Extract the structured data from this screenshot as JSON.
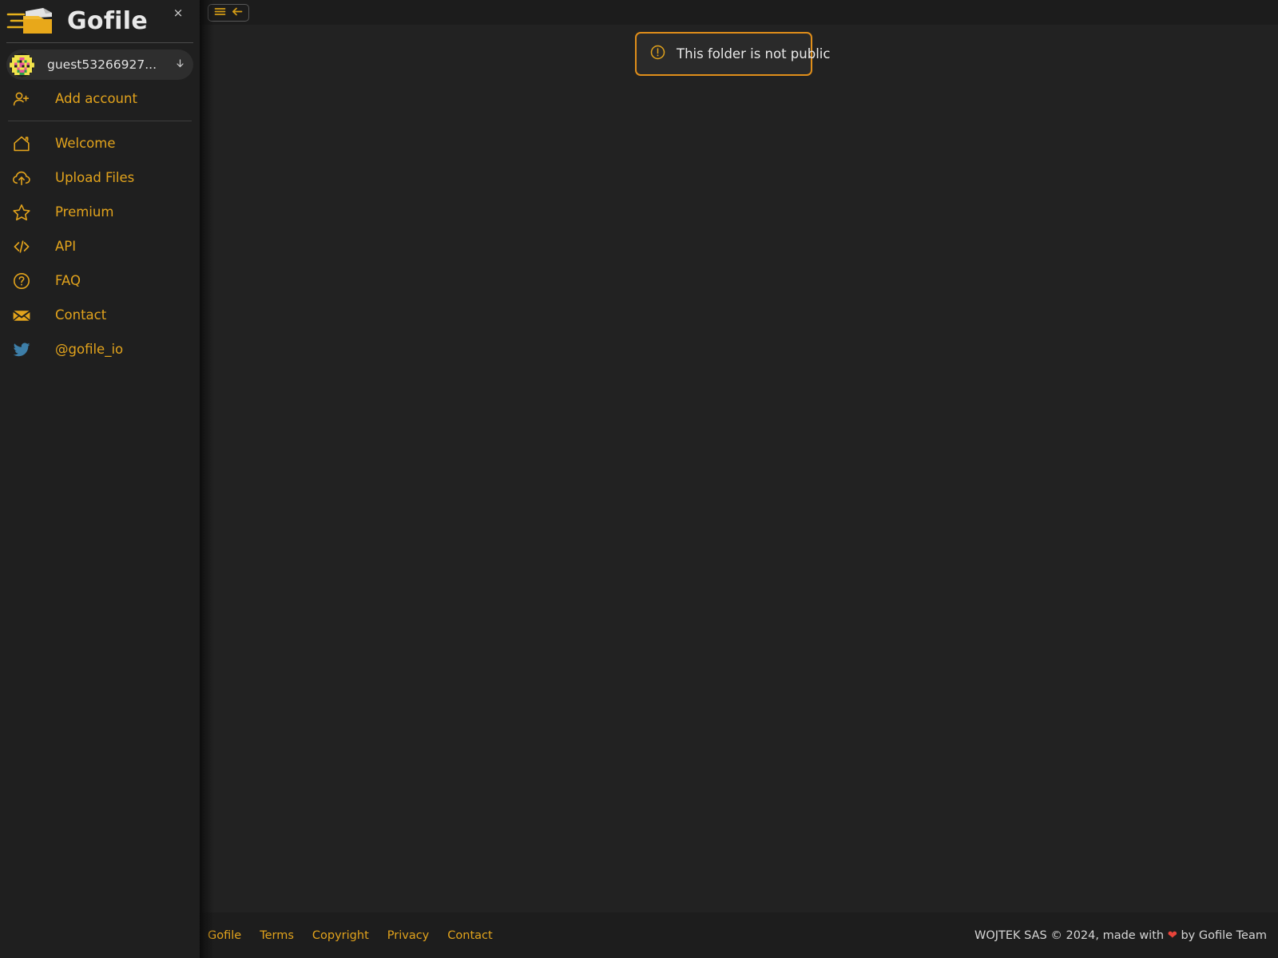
{
  "window": {
    "close_label": "×"
  },
  "sidebar": {
    "brand": {
      "title": "Gofile",
      "logo_icon": "gofile-folder-logo"
    },
    "account": {
      "name": "guest53266927...",
      "caret_icon": "chevron-down-icon",
      "avatar_icon": "identicon-avatar"
    },
    "add_account": {
      "label": "Add account",
      "icon": "user-plus-icon"
    },
    "items": [
      {
        "label": "Welcome",
        "icon": "home-icon"
      },
      {
        "label": "Upload Files",
        "icon": "cloud-upload-icon"
      },
      {
        "label": "Premium",
        "icon": "star-icon"
      },
      {
        "label": "API",
        "icon": "code-brackets-icon"
      },
      {
        "label": "FAQ",
        "icon": "question-circle-icon"
      },
      {
        "label": "Contact",
        "icon": "envelope-icon"
      },
      {
        "label": "@gofile_io",
        "icon": "twitter-bird-icon"
      }
    ]
  },
  "toolbar": {
    "menu_icon": "hamburger-menu-icon",
    "back_icon": "arrow-left-icon"
  },
  "main": {
    "alert": {
      "text": "This folder is not public",
      "icon": "warning-circle-icon"
    }
  },
  "footer": {
    "links": [
      {
        "label": "Gofile"
      },
      {
        "label": "Terms"
      },
      {
        "label": "Copyright"
      },
      {
        "label": "Privacy"
      },
      {
        "label": "Contact"
      }
    ],
    "copyright_prefix": "WOJTEK SAS © 2024, made with",
    "heart": "❤",
    "copyright_suffix": "by Gofile Team"
  },
  "colors": {
    "accent": "#e2a31c",
    "alert_border": "#e08e1a",
    "sidebar_bg": "#1f1f1f",
    "main_bg": "#222222",
    "footer_bg": "#1d1d1d",
    "twitter_blue": "#3d7ea8",
    "heart_red": "#e8443a"
  }
}
